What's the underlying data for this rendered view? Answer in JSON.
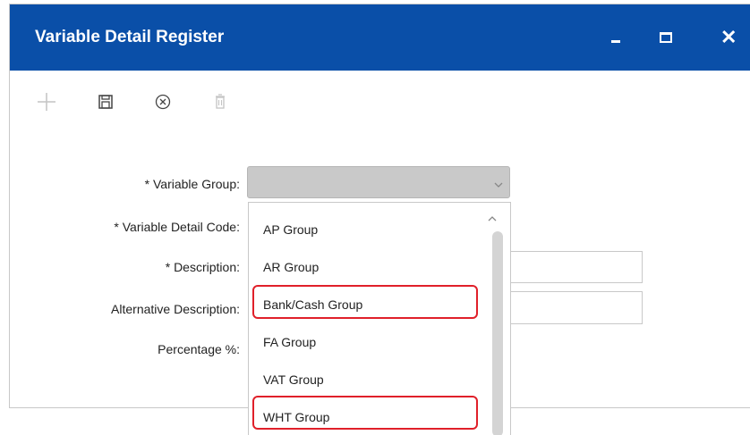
{
  "window": {
    "title": "Variable Detail Register",
    "controls": [
      "minimize",
      "maximize",
      "close"
    ],
    "title_bar_color": "#0a4fa8"
  },
  "toolbar": {
    "icons": [
      "add-icon",
      "save-icon",
      "cancel-icon",
      "delete-icon"
    ]
  },
  "form": {
    "variable_group_label": "* Variable Group:",
    "variable_detail_code_label": "* Variable Detail Code:",
    "description_label": "* Description:",
    "alternative_description_label": "Alternative Description:",
    "percentage_label": "Percentage %:",
    "variable_group_value": ""
  },
  "dropdown": {
    "options": [
      {
        "label": "AP Group",
        "highlighted": false
      },
      {
        "label": "AR Group",
        "highlighted": false
      },
      {
        "label": "Bank/Cash Group",
        "highlighted": true
      },
      {
        "label": "FA Group",
        "highlighted": false
      },
      {
        "label": "VAT Group",
        "highlighted": false
      },
      {
        "label": "WHT Group",
        "highlighted": true
      }
    ],
    "highlight_color": "#e0202a"
  }
}
